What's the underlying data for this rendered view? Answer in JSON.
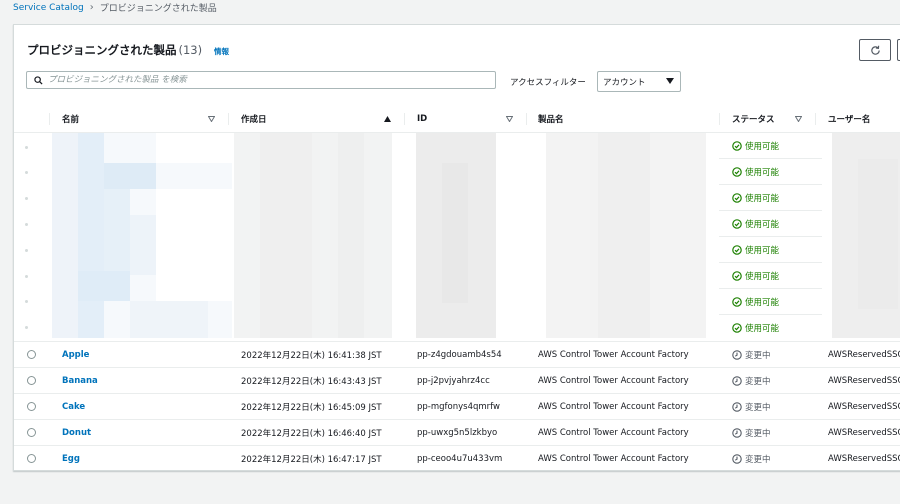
{
  "breadcrumb": {
    "root": "Service Catalog",
    "current": "プロビジョニングされた製品"
  },
  "panel": {
    "title": "プロビジョニングされた製品",
    "count": "(13)",
    "info": "情報"
  },
  "search": {
    "placeholder": "プロビジョニングされた製品 を検索"
  },
  "filter": {
    "label": "アクセスフィルター",
    "selected": "アカウント"
  },
  "columns": [
    "名前",
    "作成日",
    "ID",
    "製品名",
    "ステータス",
    "ユーザー名"
  ],
  "blurred_statuses": [
    "使用可能",
    "使用可能",
    "使用可能",
    "使用可能",
    "使用可能",
    "使用可能",
    "使用可能",
    "使用可能"
  ],
  "rows": [
    {
      "name": "Apple",
      "created": "2022年12月22日(木) 16:41:38 JST",
      "id": "pp-z4gdouamb4s54",
      "product": "AWS Control Tower Account Factory",
      "status": "変更中",
      "user": "AWSReservedSSO"
    },
    {
      "name": "Banana",
      "created": "2022年12月22日(木) 16:43:43 JST",
      "id": "pp-j2pvjyahrz4cc",
      "product": "AWS Control Tower Account Factory",
      "status": "変更中",
      "user": "AWSReservedSSO"
    },
    {
      "name": "Cake",
      "created": "2022年12月22日(木) 16:45:09 JST",
      "id": "pp-mgfonys4qmrfw",
      "product": "AWS Control Tower Account Factory",
      "status": "変更中",
      "user": "AWSReservedSSO"
    },
    {
      "name": "Donut",
      "created": "2022年12月22日(木) 16:46:40 JST",
      "id": "pp-uwxg5n5lzkbyo",
      "product": "AWS Control Tower Account Factory",
      "status": "変更中",
      "user": "AWSReservedSSO"
    },
    {
      "name": "Egg",
      "created": "2022年12月22日(木) 16:47:17 JST",
      "id": "pp-ceoo4u7u433vm",
      "product": "AWS Control Tower Account Factory",
      "status": "変更中",
      "user": "AWSReservedSSO"
    }
  ],
  "colors": {
    "link": "#0073bb",
    "available": "#1d8102",
    "text": "#16191f"
  }
}
